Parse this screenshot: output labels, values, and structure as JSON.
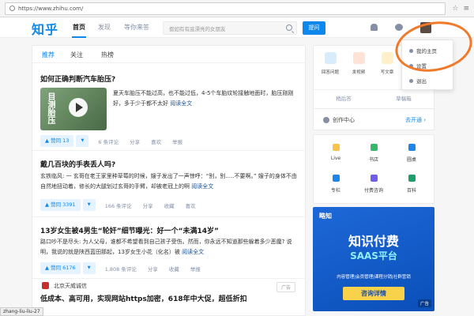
{
  "browser": {
    "url": "https://www.zhihu.com/"
  },
  "header": {
    "logo": "知乎",
    "nav": [
      "首页",
      "发现",
      "等你来答"
    ],
    "search_placeholder": "假如有有底漂亮的女朋友",
    "ask_label": "提问"
  },
  "feed": {
    "tabs": [
      "推荐",
      "关注",
      "热榜"
    ],
    "cards": [
      {
        "title": "如何正确判断汽车胎压?",
        "excerpt": "夏天车胎压不能过高，也不能过低，4-5个车胎纹轮接触地面时，胎压刚刚好，多于少于都不太好",
        "read_more": "阅读全文",
        "thumb_text": "目测胎压",
        "vote": "▲ 赞同 13",
        "comments": "6 条评论",
        "share": "分享",
        "like": "喜欢",
        "report": "举报"
      },
      {
        "title": "戴几百块的手表丢人吗?",
        "excerpt": "玄铁临风: 一 玄哥在老王家里种草莓的时候，嫂子发出了一声惊呼：“别，别.....不要啊。” 嫂子的身体不由自然地扭动着，修长的大腿划过玄哥的手臂，却被老冠上的啊",
        "read_more": "阅读全文",
        "vote": "▲ 赞同 3391",
        "comments": "166 条评论",
        "share": "分享",
        "like": "收藏",
        "report": "喜欢"
      },
      {
        "title": "13岁女生被4男生“轮奸”细节曝光：好一个“未满14岁”",
        "excerpt": "路口吵不是尽头: 为人父母，谁都不希望看到自己孩子受伤。然而，你永远不知道那些躲着多少恶魔? 说明，我说的就是陕西蓝田那起，13岁女生小花（化名）被",
        "read_more": "阅读全文",
        "vote": "▲ 赞同 6176",
        "comments": "1,808 条评论",
        "share": "分享",
        "like": "收藏",
        "report": "举报"
      }
    ],
    "ad": {
      "source": "北京天威诚信",
      "badge": "广告",
      "title": "低成本、高可用，实现网站https加密，618年中大促，超低折扣"
    }
  },
  "sidebar": {
    "create": [
      {
        "label": "回答问题",
        "color": "#d9ecfc"
      },
      {
        "label": "发视频",
        "color": "#ffe3d6"
      },
      {
        "label": "写文章",
        "color": "#fff0c9"
      }
    ],
    "sub_links": [
      "稍后答",
      "草稿箱"
    ],
    "creator_label": "创作中心",
    "creator_link": "去开通 ›",
    "services": [
      {
        "label": "Live",
        "color": "#f8c34a"
      },
      {
        "label": "书店",
        "color": "#35b96a"
      },
      {
        "label": "圆桌",
        "color": "#1e86e8"
      },
      {
        "label": "专栏",
        "color": "#1e86e8"
      },
      {
        "label": "付费咨询",
        "color": "#6e5ee8"
      },
      {
        "label": "百科",
        "color": "#1e9f6a"
      }
    ],
    "banner": {
      "logo": "略知",
      "title": "知识付费",
      "subtitle": "SAAS平台",
      "desc": "内容管理|会员管理|课程分销|社群营销",
      "button": "咨询详情",
      "ad": "广告"
    }
  },
  "dropdown": [
    "我的主页",
    "设置",
    "退出"
  ],
  "status_url": "zhang-liu-liu-27"
}
